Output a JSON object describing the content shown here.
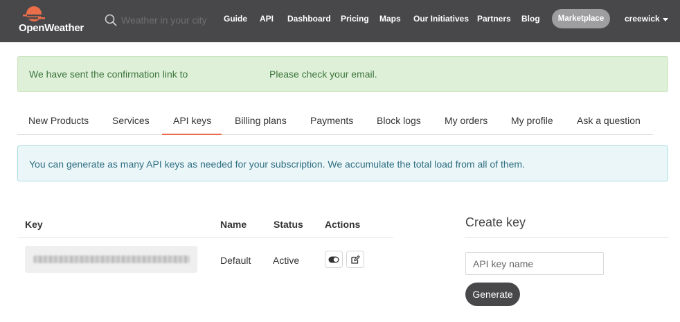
{
  "header": {
    "brand": "OpenWeather",
    "search": {
      "placeholder": "Weather in your city"
    },
    "nav": [
      "Guide",
      "API",
      "Dashboard",
      "Pricing",
      "Maps",
      "Our Initiatives",
      "Partners",
      "Blog"
    ],
    "marketplace_label": "Marketplace",
    "username": "creewick"
  },
  "alerts": {
    "confirmation_part1": "We have sent the confirmation link to",
    "confirmation_part2": "Please check your email.",
    "info": "You can generate as many API keys as needed for your subscription. We accumulate the total load from all of them."
  },
  "tabs": {
    "items": [
      "New Products",
      "Services",
      "API keys",
      "Billing plans",
      "Payments",
      "Block logs",
      "My orders",
      "My profile",
      "Ask a question"
    ],
    "active": "API keys"
  },
  "keys_table": {
    "headers": {
      "key": "Key",
      "name": "Name",
      "status": "Status",
      "actions": "Actions"
    },
    "rows": [
      {
        "name": "Default",
        "status": "Active"
      }
    ]
  },
  "create_key": {
    "title": "Create key",
    "input_placeholder": "API key name",
    "button_label": "Generate"
  },
  "colors": {
    "header_bg": "#48484a",
    "accent": "#eb6e4b",
    "success_bg": "#dff0d8",
    "info_bg": "#ebf6f9"
  }
}
